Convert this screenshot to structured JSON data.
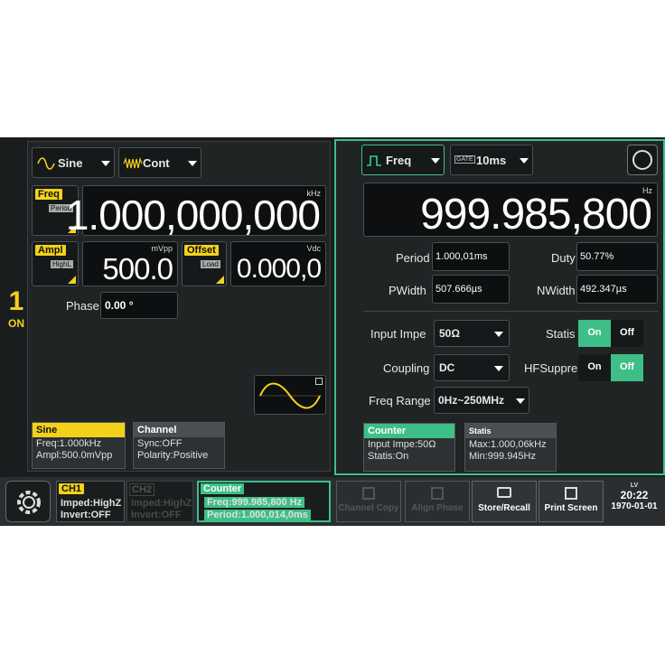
{
  "ch1": {
    "number": "1",
    "state": "ON",
    "waveform": "Sine",
    "mode": "Cont",
    "freq_label": "Freq",
    "freq_sub": "Period",
    "freq_unit": "kHz",
    "freq_value": "1.000,000,000",
    "ampl_label": "Ampl",
    "ampl_sub": "HighL",
    "ampl_unit": "mVpp",
    "ampl_value": "500.0",
    "offset_label": "Offset",
    "offset_sub": "Load",
    "offset_unit": "Vdc",
    "offset_value": "0.000,0",
    "phase_label": "Phase",
    "phase_value": "0.00 °",
    "info_sine_title": "Sine",
    "info_sine_freq": "Freq:1.000kHz",
    "info_sine_ampl": "Ampl:500.0mVpp",
    "info_channel_title": "Channel",
    "info_channel_sync": "Sync:OFF",
    "info_channel_polarity": "Polarity:Positive"
  },
  "counter": {
    "state": "RUN",
    "measure": "Freq",
    "gate_icon": "GATE",
    "gate": "10ms",
    "hz_unit": "Hz",
    "value": "999.985,800",
    "period_label": "Period",
    "period_value": "1.000,01ms",
    "duty_label": "Duty",
    "duty_value": "50.77%",
    "pwidth_label": "PWidth",
    "pwidth_value": "507.666µs",
    "nwidth_label": "NWidth",
    "nwidth_value": "492.347µs",
    "input_label": "Input Impe",
    "input_value": "50Ω",
    "statis_label": "Statis",
    "statis_on": "On",
    "statis_off": "Off",
    "coupling_label": "Coupling",
    "coupling_value": "DC",
    "hf_label": "HFSuppre",
    "hf_on": "On",
    "hf_off": "Off",
    "range_label": "Freq Range",
    "range_value": "0Hz~250MHz",
    "info_counter_title": "Counter",
    "info_counter_input": "Input Impe:50Ω",
    "info_counter_statis": "Statis:On",
    "info_statis_title": "Statis",
    "info_statis_max": "Max:1.000,06kHz",
    "info_statis_min": "Min:999.945Hz"
  },
  "bottom": {
    "ch1_title": "CH1",
    "ch1_imped": "Imped:HighZ",
    "ch1_invert": "Invert:OFF",
    "ch2_title": "CH2",
    "ch2_imped": "Imped:HighZ",
    "ch2_invert": "Invert:OFF",
    "counter_title": "Counter",
    "counter_freq": "Freq:999.985,800 Hz",
    "counter_period": "Period:1.000,014,0ms",
    "btn_channel_copy": "Channel Copy",
    "btn_align_phase": "Align Phase",
    "btn_store_recall": "Store/Recall",
    "btn_print_screen": "Print Screen",
    "lan": "LV",
    "time": "20:22",
    "date": "1970-01-01"
  }
}
